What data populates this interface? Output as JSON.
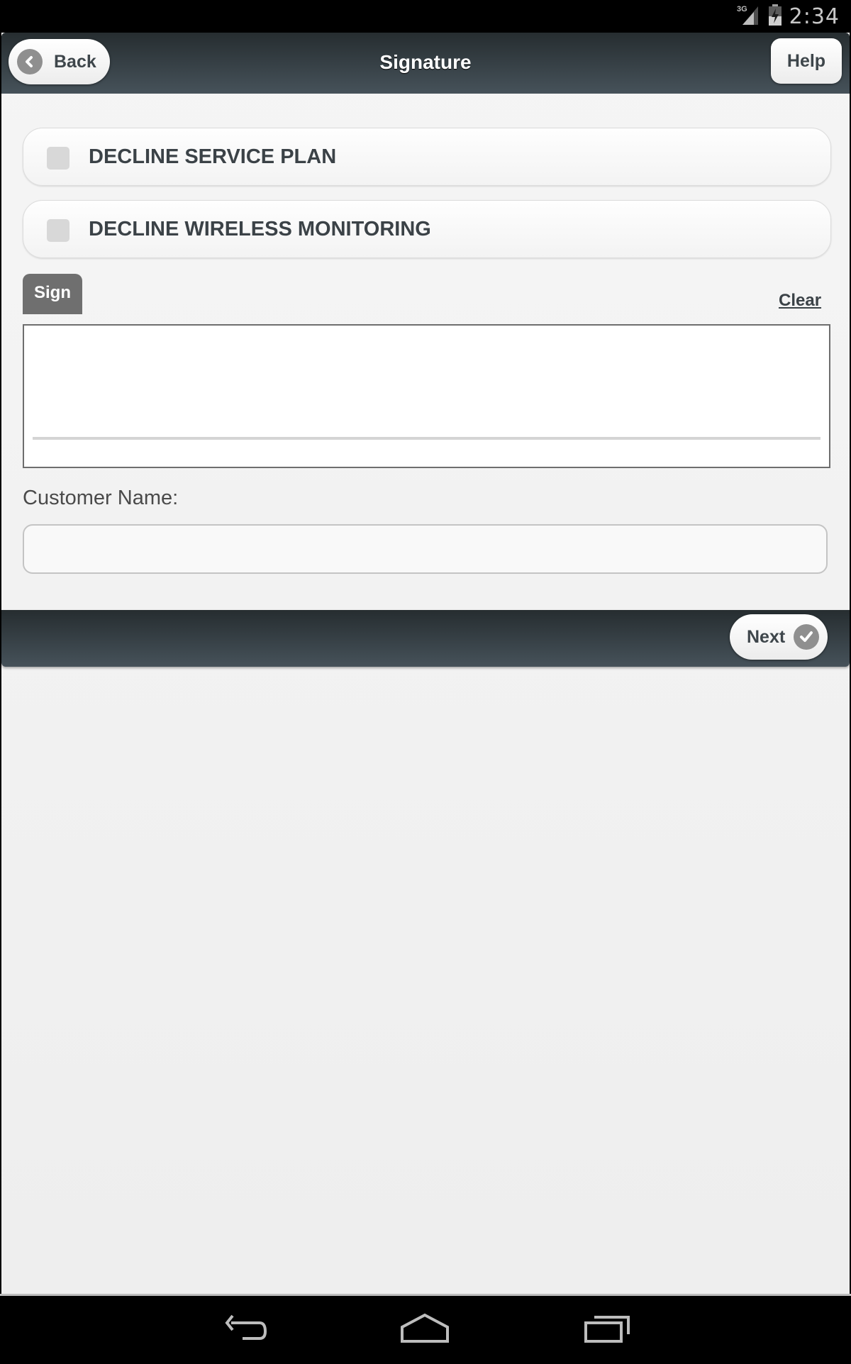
{
  "status_bar": {
    "network": "3G",
    "time": "2:34",
    "icons": [
      "signal-3g-icon",
      "battery-charging-icon"
    ]
  },
  "header": {
    "title": "Signature",
    "back_label": "Back",
    "back_icon": "chevron-left-icon",
    "help_label": "Help"
  },
  "options": [
    {
      "label": "DECLINE SERVICE PLAN",
      "checked": false
    },
    {
      "label": "DECLINE WIRELESS MONITORING",
      "checked": false
    }
  ],
  "signature": {
    "tab_label": "Sign",
    "clear_label": "Clear"
  },
  "customer": {
    "label": "Customer Name:",
    "value": "",
    "placeholder": ""
  },
  "footer": {
    "next_label": "Next",
    "next_icon": "checkmark-icon"
  },
  "nav_bar": {
    "buttons": [
      "back-nav-icon",
      "home-nav-icon",
      "recents-nav-icon"
    ]
  }
}
